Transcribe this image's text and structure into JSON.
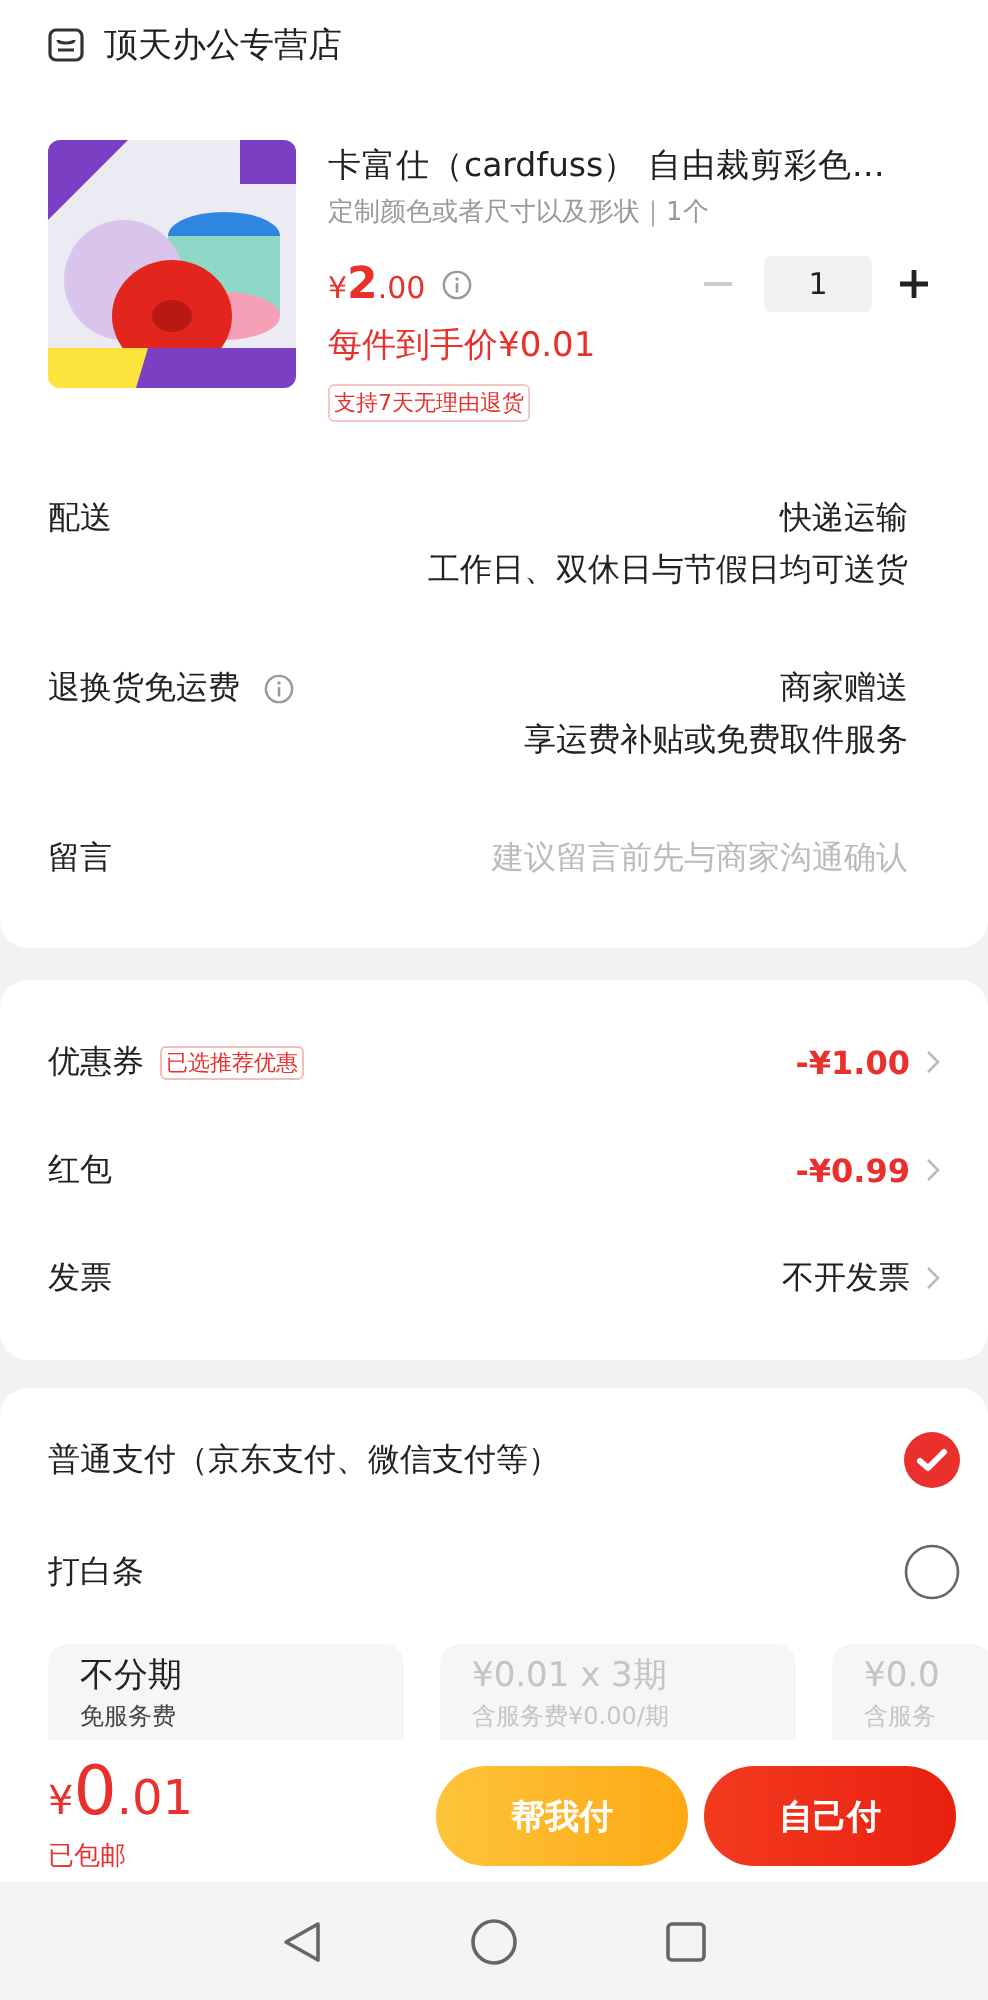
{
  "store": {
    "name": "顶天办公专营店"
  },
  "product": {
    "title": "卡富仕（cardfuss） 自由裁剪彩色…",
    "spec": "定制颜色或者尺寸以及形状｜1个",
    "price": {
      "currency": "¥",
      "integer": "2",
      "decimal": ".00"
    },
    "quantity": "1",
    "decrease_disabled": true,
    "final_price": "每件到手价¥0.01",
    "tag": "支持7天无理由退货"
  },
  "info_rows": [
    {
      "label": "配送",
      "info_icon": false,
      "kind": "value",
      "values": [
        "快递运输",
        "工作日、双休日与节假日均可送货"
      ]
    },
    {
      "label": "退换货免运费",
      "info_icon": true,
      "kind": "value",
      "values": [
        "商家赠送",
        "享运费补贴或免费取件服务"
      ]
    },
    {
      "label": "留言",
      "info_icon": false,
      "kind": "input",
      "placeholder": "建议留言前先与商家沟通确认"
    }
  ],
  "discounts": [
    {
      "label": "优惠券",
      "badge": "已选推荐优惠",
      "value": "-¥1.00",
      "kind": "deduction"
    },
    {
      "label": "红包",
      "value": "-¥0.99",
      "kind": "deduction"
    },
    {
      "label": "发票",
      "value": "不开发票",
      "kind": "plain"
    }
  ],
  "payment": {
    "options": [
      {
        "label": "普通支付（京东支付、微信支付等）",
        "selected": true
      },
      {
        "label": "打白条",
        "selected": false
      }
    ],
    "plans": [
      {
        "title": "不分期",
        "subtitle": "免服务费",
        "disabled": false
      },
      {
        "title": "¥0.01 x 3期",
        "subtitle": "含服务费¥0.00/期",
        "disabled": true
      },
      {
        "title": "¥0.0",
        "subtitle": "含服务",
        "disabled": true
      }
    ]
  },
  "footer": {
    "total": {
      "currency": "¥",
      "integer": "0",
      "decimal": ".01"
    },
    "shipping": "已包邮",
    "buttons": [
      {
        "label": "帮我付",
        "kind": "secondary"
      },
      {
        "label": "自己付",
        "kind": "primary"
      }
    ]
  }
}
